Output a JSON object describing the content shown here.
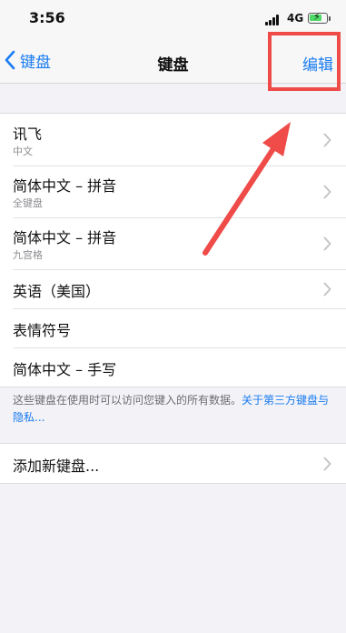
{
  "status_bar": {
    "time": "3:56",
    "network": "4G"
  },
  "nav": {
    "back_label": "键盘",
    "title": "键盘",
    "edit_label": "编辑"
  },
  "keyboards": [
    {
      "title": "讯飞",
      "subtitle": "中文"
    },
    {
      "title": "简体中文 – 拼音",
      "subtitle": "全键盘"
    },
    {
      "title": "简体中文 – 拼音",
      "subtitle": "九宫格"
    },
    {
      "title": "英语（美国）",
      "subtitle": ""
    },
    {
      "title": "表情符号",
      "subtitle": ""
    },
    {
      "title": "简体中文 – 手写",
      "subtitle": ""
    }
  ],
  "footnote": {
    "text": "这些键盘在使用时可以访问您键入的所有数据。",
    "link": "关于第三方键盘与隐私..."
  },
  "add_keyboard_label": "添加新键盘...",
  "colors": {
    "accent": "#1a7cf2",
    "annotation": "#ef4b48"
  },
  "icons": [
    "back-chevron-icon",
    "chevron-right-icon",
    "signal-icon",
    "battery-icon",
    "annotation-arrow"
  ]
}
